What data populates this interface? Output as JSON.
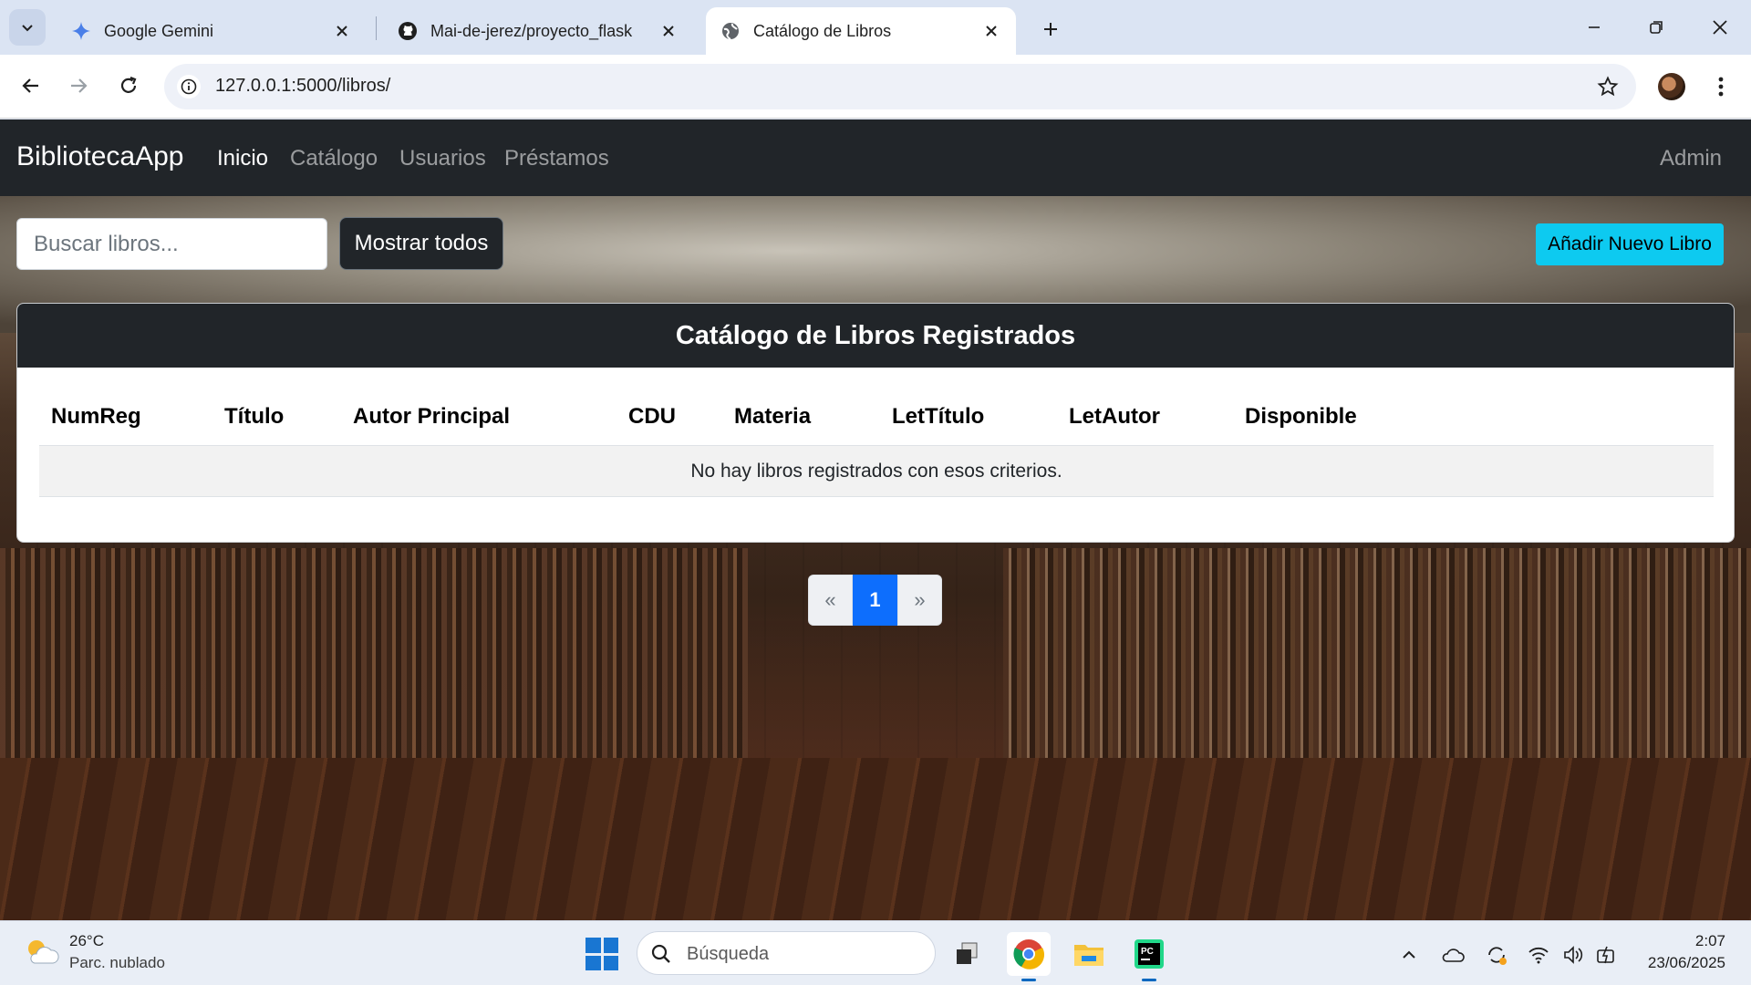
{
  "browser": {
    "tabs": [
      {
        "title": "Google Gemini",
        "active": false
      },
      {
        "title": "Mai-de-jerez/proyecto_flask",
        "active": false
      },
      {
        "title": "Catálogo de Libros",
        "active": true
      }
    ],
    "url": "127.0.0.1:5000/libros/"
  },
  "navbar": {
    "brand": "BibliotecaApp",
    "links": [
      "Inicio",
      "Catálogo",
      "Usuarios",
      "Préstamos"
    ],
    "active_link": "Inicio",
    "user": "Admin"
  },
  "search": {
    "placeholder": "Buscar libros...",
    "value": "",
    "show_all_label": "Mostrar todos"
  },
  "add_book_label": "Añadir Nuevo Libro",
  "catalog": {
    "title": "Catálogo de Libros Registrados",
    "columns": [
      "NumReg",
      "Título",
      "Autor Principal",
      "CDU",
      "Materia",
      "LetTítulo",
      "LetAutor",
      "Disponible"
    ],
    "empty_message": "No hay libros registrados con esos criterios."
  },
  "pagination": {
    "prev": "«",
    "current": "1",
    "next": "»"
  },
  "taskbar": {
    "weather_temp": "26°C",
    "weather_desc": "Parc. nublado",
    "search_label": "Búsqueda",
    "time": "2:07",
    "date": "23/06/2025"
  },
  "colors": {
    "navbar": "#212529",
    "accent_info": "#0dcaf0",
    "page_active": "#0d6efd"
  }
}
